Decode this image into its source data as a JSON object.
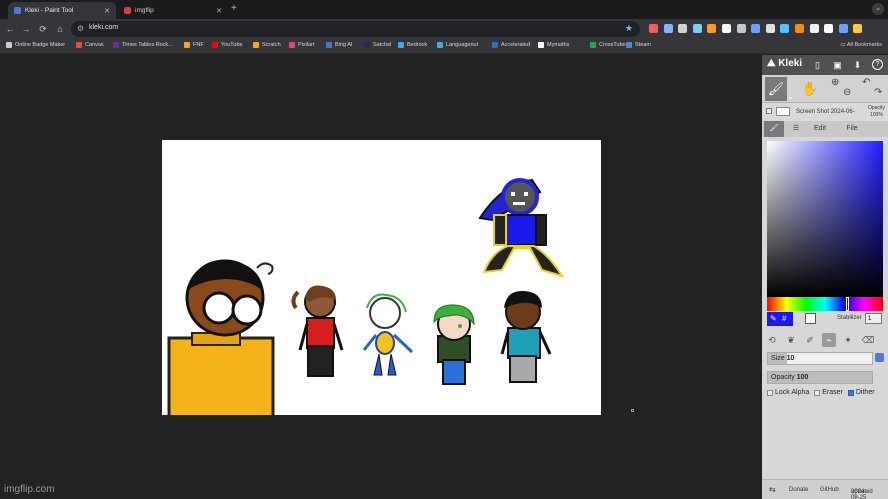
{
  "browser": {
    "tabs": [
      {
        "title": "Kleki - Paint Tool",
        "favicon_color": "#4a7bd8",
        "active": true
      },
      {
        "title": "imgflip",
        "favicon_color": "#d93f3f",
        "active": false
      }
    ],
    "new_tab_glyph": "+",
    "tab_close_glyph": "✕",
    "tab_menu_glyph": "⌄",
    "url": "kleki.com",
    "nav": {
      "back": "←",
      "forward": "→",
      "reload": "⟳",
      "home": "⌂",
      "tune": "⚙",
      "star": "★"
    },
    "extension_colors": [
      "#ff5a5a",
      "#8ab4f8",
      "#d0d0d0",
      "#7ad0f0",
      "#ff9a2a",
      "#f5f5f5",
      "#c7c7c7",
      "#6aa0ff",
      "#e0e0e0",
      "#58c0ff",
      "#ff8800",
      "#eeeeee",
      "#ffffff",
      "#6aa0ff",
      "#ffcc33"
    ],
    "bookmarks": [
      {
        "label": "Online Badge Maker",
        "icon_color": "#cccccc"
      },
      {
        "label": "Canvas",
        "icon_color": "#e34c4c"
      },
      {
        "label": "Times Tables Rock...",
        "icon_color": "#6b2fa0"
      },
      {
        "label": "FNF",
        "icon_color": "#f0a030"
      },
      {
        "label": "YouTube",
        "icon_color": "#ff0000"
      },
      {
        "label": "Scratch",
        "icon_color": "#f5a623"
      },
      {
        "label": "Pixilart",
        "icon_color": "#e0457b"
      },
      {
        "label": "Bing AI",
        "icon_color": "#3c7bd5"
      },
      {
        "label": "Satchel",
        "icon_color": "#1f2f5a"
      },
      {
        "label": "Bedrock",
        "icon_color": "#4aa6e0"
      },
      {
        "label": "Languagenut",
        "icon_color": "#3cb0d0"
      },
      {
        "label": "Accelerated",
        "icon_color": "#2e6dd0"
      },
      {
        "label": "Mymaths",
        "icon_color": "#ffffff"
      },
      {
        "label": "CrossTube",
        "icon_color": "#2fa05a"
      },
      {
        "label": "Steam",
        "icon_color": "#4a8cd8"
      }
    ],
    "all_bookmarks": "All Bookmarks"
  },
  "workspace": {
    "background": "#222222",
    "watermark": "imgflip.com"
  },
  "kleki": {
    "logo": "Kleki",
    "topbar_icons": {
      "new": "▯",
      "save": "▣",
      "download": "⬇",
      "help": "?"
    },
    "tools": {
      "brush": "🖌",
      "hand": "✋",
      "zoom_in": "⊕",
      "zoom_out": "⊖",
      "undo": "↶",
      "redo": "↷",
      "dropdown": "⌄"
    },
    "layer": {
      "name": "Screen Shot 2024-06-",
      "opacity_label": "Opacity",
      "opacity_value": "100%"
    },
    "tabs": {
      "brush": "🖌",
      "layers": "☰",
      "edit": "Edit",
      "file": "File"
    },
    "primary_color": "#1a1aee",
    "secondary_color": "#ffffff",
    "hex_glyph": "#",
    "eyedropper_glyph": "✎",
    "stabilizer_label": "Stabilizer",
    "stabilizer_value": "1",
    "brushes": [
      "⟲",
      "❦",
      "✐",
      "⌁",
      "✦",
      "⌫"
    ],
    "size_label": "Size",
    "size_value": "10",
    "size_fraction": 0.18,
    "opacity_label": "Opacity",
    "opacity_value": "100",
    "opacity_fraction": 1.0,
    "options": [
      {
        "label": "Lock Alpha",
        "checked": false
      },
      {
        "label": "Eraser",
        "checked": false
      },
      {
        "label": "Dither",
        "checked": true
      }
    ],
    "footer": {
      "arrows": "⇆",
      "donate": "Donate",
      "github": "GitHub",
      "updated_label": "updated",
      "updated_date": "2024-08-25"
    }
  }
}
